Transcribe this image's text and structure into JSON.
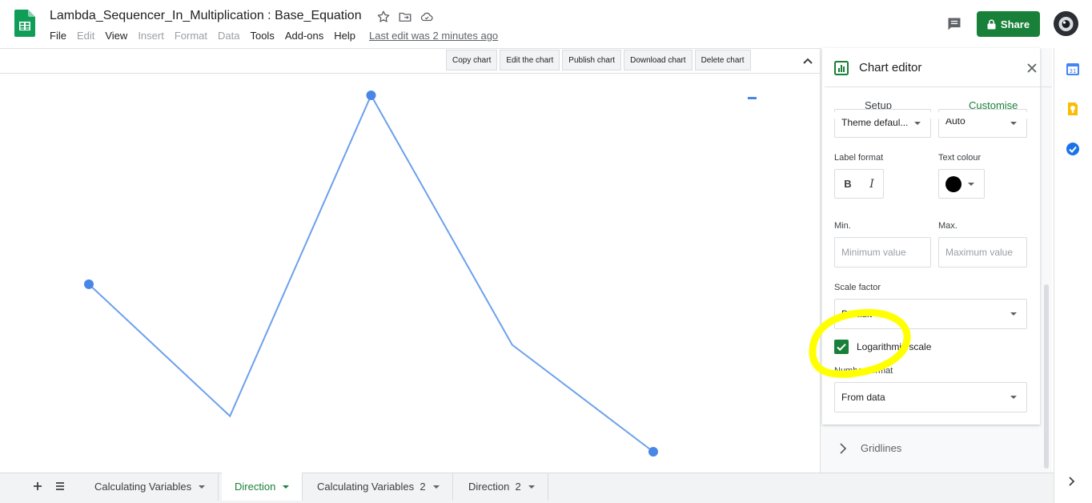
{
  "header": {
    "doc_title": "Lambda_Sequencer_In_Multiplication : Base_Equation",
    "menu": [
      {
        "label": "File",
        "enabled": true
      },
      {
        "label": "Edit",
        "enabled": false
      },
      {
        "label": "View",
        "enabled": true
      },
      {
        "label": "Insert",
        "enabled": false
      },
      {
        "label": "Format",
        "enabled": false
      },
      {
        "label": "Data",
        "enabled": false
      },
      {
        "label": "Tools",
        "enabled": true
      },
      {
        "label": "Add-ons",
        "enabled": true
      },
      {
        "label": "Help",
        "enabled": true
      }
    ],
    "last_edit": "Last edit was 2 minutes ago",
    "share_label": "Share",
    "brand_color": "#188038"
  },
  "chart_toolbar": {
    "copy": "Copy chart",
    "edit": "Edit the chart",
    "publish": "Publish chart",
    "download": "Download chart",
    "delete": "Delete chart"
  },
  "chart_data": {
    "type": "line",
    "x": [
      1,
      2,
      3,
      4,
      5
    ],
    "y_relative_scale": "logarithmic",
    "values": [
      0.47,
      0.1,
      1.0,
      0.3,
      0.0
    ],
    "line_color": "#6ca0ec",
    "marker_color": "#4a86e8",
    "markers_on": [
      1,
      3,
      5
    ],
    "legend_marker": "top-right"
  },
  "editor": {
    "title": "Chart editor",
    "tabs": {
      "setup": "Setup",
      "customise": "Customise"
    },
    "font_select": "Theme defaul...",
    "size_select": "Auto",
    "label_format_label": "Label format",
    "bold_label": "B",
    "italic_label": "I",
    "text_colour_label": "Text colour",
    "text_colour_value": "#000000",
    "min_label": "Min.",
    "max_label": "Max.",
    "min_placeholder": "Minimum value",
    "max_placeholder": "Maximum value",
    "scale_factor_label": "Scale factor",
    "scale_factor_value": "Default",
    "log_scale_label": "Logarithmic scale",
    "log_scale_checked": true,
    "number_format_label": "Number format",
    "number_format_value": "From data",
    "gridlines_label": "Gridlines",
    "highlight_color": "#ffff00"
  },
  "sheets": {
    "tabs": [
      {
        "label": "Calculating Variables",
        "active": false
      },
      {
        "label": "Direction",
        "active": true
      },
      {
        "label": "Calculating Variables  2",
        "active": false
      },
      {
        "label": "Direction  2",
        "active": false
      }
    ]
  }
}
